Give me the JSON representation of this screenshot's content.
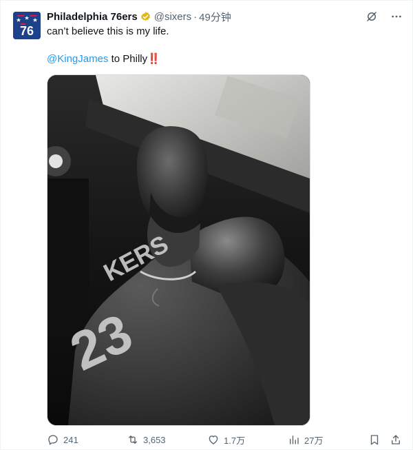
{
  "tweet": {
    "author_name": "Philadelphia 76ers",
    "handle": "@sixers",
    "separator": "·",
    "time": "49分钟",
    "text_line1": "can’t believe this is my life.",
    "mention": "@KingJames",
    "text_after_mention": " to Philly",
    "emoji": "‼️",
    "avatar_text": "76"
  },
  "actions": {
    "replies": "241",
    "retweets": "3,653",
    "likes": "1.7万",
    "views": "27万"
  },
  "icons": {
    "verified": "verified-badge-icon",
    "grok": "grok-icon",
    "more": "more-icon",
    "reply": "reply-icon",
    "retweet": "retweet-icon",
    "like": "heart-icon",
    "views": "views-icon",
    "bookmark": "bookmark-icon",
    "share": "share-icon"
  },
  "colors": {
    "link": "#1d9bf0",
    "muted": "#536471",
    "verified_gold": "#e2b719",
    "avatar_bg": "#1d428a",
    "avatar_red": "#ed174c"
  }
}
